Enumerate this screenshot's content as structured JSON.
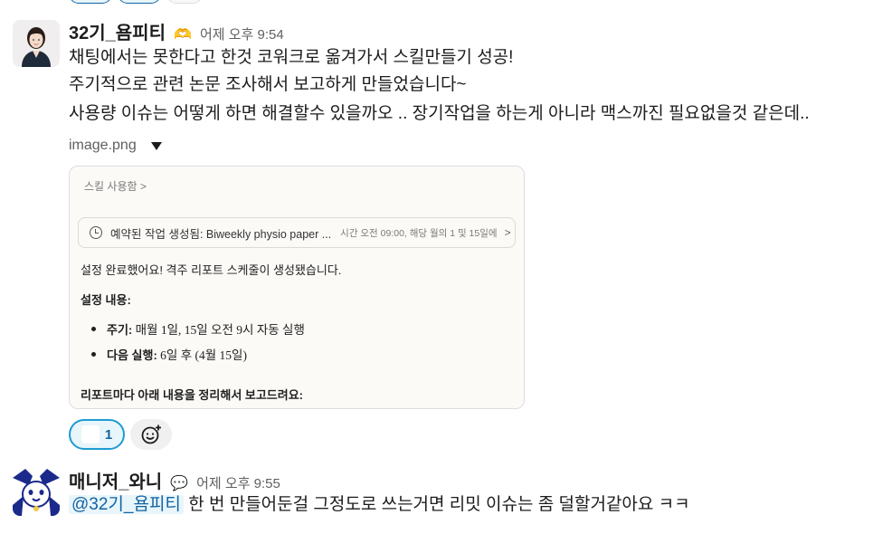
{
  "message1": {
    "username": "32기_욤피티",
    "status_emoji": "🫶",
    "timestamp": "어제 오후 9:54",
    "lines": [
      "채팅에서는 못한다고 한것 코워크로 옮겨가서 스킬만들기 성공!",
      "주기적으로 관련 논문 조사해서 보고하게 만들었습니다~",
      "사용량 이슈는 어떻게 하면 해결할수 있을까오 .. 장기작업을 하는게 아니라 맥스까진 필요없을것 같은데.."
    ],
    "file": {
      "name": "image.png"
    },
    "image": {
      "breadcrumb": "스킬 사용함 >",
      "task_title": "예약된 작업 생성됨: Biweekly physio paper ...",
      "task_meta": "시간 오전 09:00, 해당 월의 1 및 15일에",
      "task_arrow": ">",
      "done_text": "설정 완료했어요! 격주 리포트 스케줄이 생성됐습니다.",
      "settings_heading": "설정 내용:",
      "bullets": [
        {
          "label": "주기:",
          "value": "매월 1일, 15일 오전 9시 자동 실행"
        },
        {
          "label": "다음 실행:",
          "value": "6일 후 (4월 15일)"
        }
      ],
      "report_heading": "리포트마다 아래 내용을 정리해서 보고드려요:"
    },
    "reactions": [
      {
        "count": "1",
        "selected": true
      }
    ],
    "add_reaction_icon": "add-reaction-icon"
  },
  "message2": {
    "username": "매니저_와니",
    "status_emoji": "💬",
    "timestamp": "어제 오후 9:55",
    "mention": "@32기_욤피티",
    "text": "한 번 만들어둔걸 그정도로 쓰는거면 리밋 이슈는 좀 덜할거같아요 ㅋㅋ"
  },
  "colors": {
    "mention_bg": "#e8f5fa",
    "mention_text": "#1264a3",
    "reaction_border": "#1d9bd1"
  }
}
